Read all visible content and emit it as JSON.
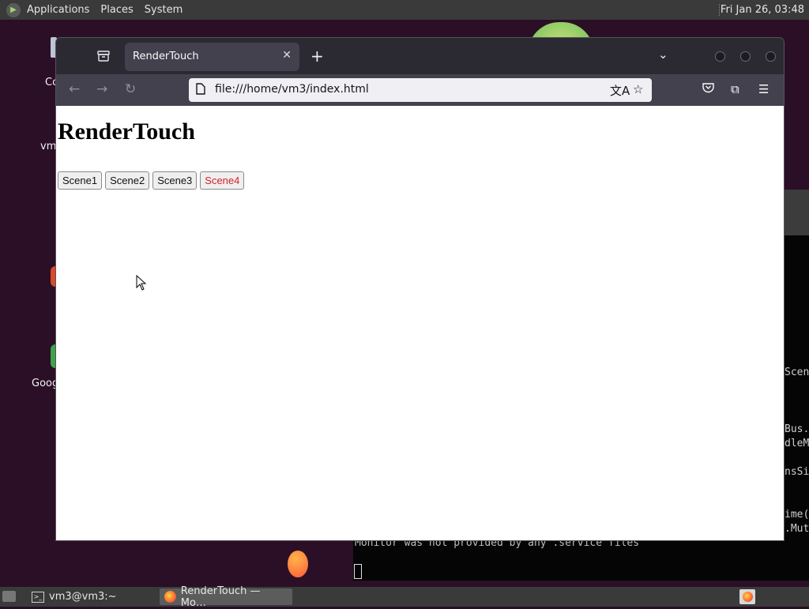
{
  "top_panel": {
    "menus": [
      "Applications",
      "Places",
      "System"
    ],
    "clock": "Fri Jan 26, 03:48"
  },
  "desktop": {
    "icon_labels": [
      "Co",
      "vm",
      "Goog"
    ]
  },
  "terminal": {
    "right_fragments": [
      "Scen",
      "Bus.",
      "dleM",
      "nsSi",
      "ime(",
      ".Mut"
    ],
    "bottom_line": "Monitor was not provided by any .service files"
  },
  "browser": {
    "tab_title": "RenderTouch",
    "url": "file:///home/vm3/index.html",
    "page": {
      "heading": "RenderTouch",
      "scene_buttons": [
        "Scene1",
        "Scene2",
        "Scene3",
        "Scene4"
      ],
      "active_scene": "Scene4"
    }
  },
  "taskbar": {
    "tasks": [
      "vm3@vm3:~",
      "RenderTouch — Mo…"
    ]
  },
  "colors": {
    "desktop_bg": "#2a0f26",
    "panel_bg": "#3a3a3a",
    "browser_chrome": "#2b2a33",
    "active_scene_text": "#d41f2a"
  }
}
